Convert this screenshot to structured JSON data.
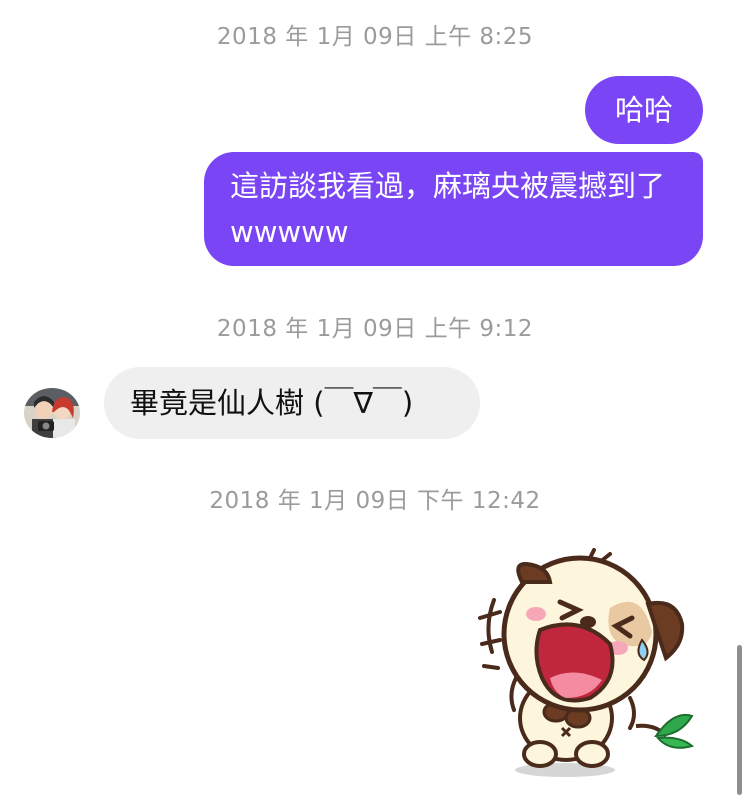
{
  "timestamps": [
    "2018 年 1月 09日 上午 8:25",
    "2018 年 1月 09日 上午 9:12",
    "2018 年 1月 09日 下午 12:42"
  ],
  "messages": {
    "out_1": "哈哈",
    "out_2": "這訪談我看過，麻璃央被震撼到了 wwwww",
    "in_1": "畢竟是仙人樹 (￣∇￣)"
  },
  "colors": {
    "outgoing_bubble": "#7a46f5",
    "incoming_bubble": "#efefef",
    "timestamp_text": "#9b9b9b"
  },
  "icons": {
    "avatar": "contact-avatar-photo",
    "sticker": "laughing-puppy-sticker"
  }
}
